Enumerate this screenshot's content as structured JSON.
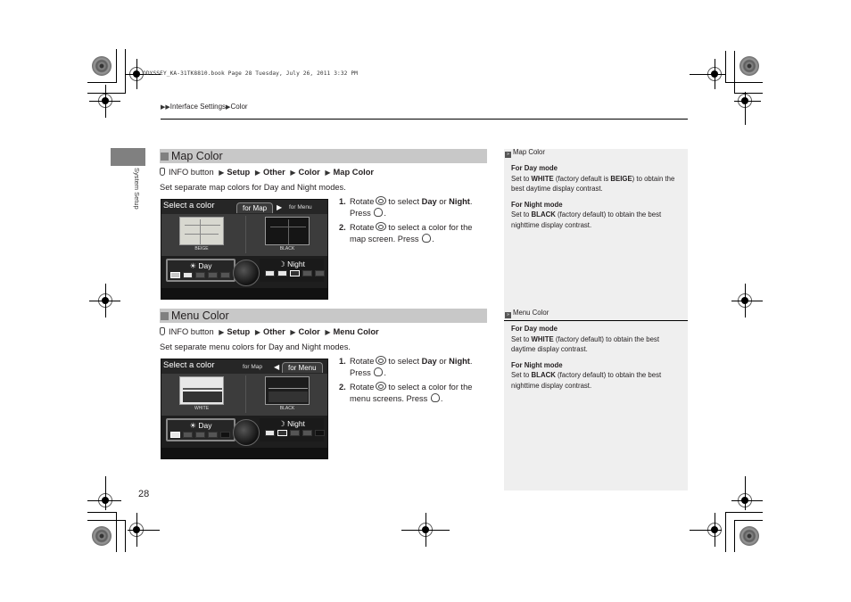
{
  "print_header": "ODYSSEY_KA-31TK8810.book  Page 28  Tuesday, July 26, 2011  3:32 PM",
  "breadcrumb": {
    "items": [
      "Interface Settings",
      "Color"
    ]
  },
  "side_tab": {
    "label": "System Setup"
  },
  "page_number": "28",
  "sections": [
    {
      "title": "Map Color",
      "path": {
        "start": "INFO button",
        "items": [
          "Setup",
          "Other",
          "Color",
          "Map Color"
        ]
      },
      "description": "Set separate map colors for Day and Night modes.",
      "screen": {
        "title": "Select a color",
        "tab_active": "for Map",
        "tab_inactive": "for Menu",
        "left_thumb_label": "BEIGE",
        "right_thumb_label": "BLACK",
        "day_label": "Day",
        "night_label": "Night"
      },
      "steps": [
        {
          "num": "1.",
          "pre": "Rotate",
          "mid": "to select",
          "opt1": "Day",
          "or": "or",
          "opt2": "Night",
          "post": "Press"
        },
        {
          "num": "2.",
          "pre": "Rotate",
          "text": "to select a color for the map screen. Press"
        }
      ]
    },
    {
      "title": "Menu Color",
      "path": {
        "start": "INFO button",
        "items": [
          "Setup",
          "Other",
          "Color",
          "Menu Color"
        ]
      },
      "description": "Set separate menu colors for Day and Night modes.",
      "screen": {
        "title": "Select a color",
        "tab_active": "for Menu",
        "tab_inactive": "for Map",
        "left_thumb_label": "WHITE",
        "right_thumb_label": "BLACK",
        "day_label": "Day",
        "night_label": "Night"
      },
      "steps": [
        {
          "num": "1.",
          "pre": "Rotate",
          "mid": "to select",
          "opt1": "Day",
          "or": "or",
          "opt2": "Night",
          "post": "Press"
        },
        {
          "num": "2.",
          "pre": "Rotate",
          "text": "to select a color for the menu screens. Press"
        }
      ]
    }
  ],
  "notes": [
    {
      "heading": "Map Color",
      "day_title": "For Day mode",
      "day_pre": "Set to",
      "day_value": "WHITE",
      "day_mid": "(factory default is",
      "day_default": "BEIGE",
      "day_post": ") to obtain the best daytime display contrast.",
      "night_title": "For Night mode",
      "night_pre": "Set to",
      "night_value": "BLACK",
      "night_post": "(factory default) to obtain the best nighttime display contrast."
    },
    {
      "heading": "Menu Color",
      "day_title": "For Day mode",
      "day_pre": "Set to",
      "day_value": "WHITE",
      "day_post": "(factory default) to obtain the best daytime display contrast.",
      "night_title": "For Night mode",
      "night_pre": "Set to",
      "night_value": "BLACK",
      "night_post": "(factory default) to obtain the best nighttime display contrast."
    }
  ]
}
